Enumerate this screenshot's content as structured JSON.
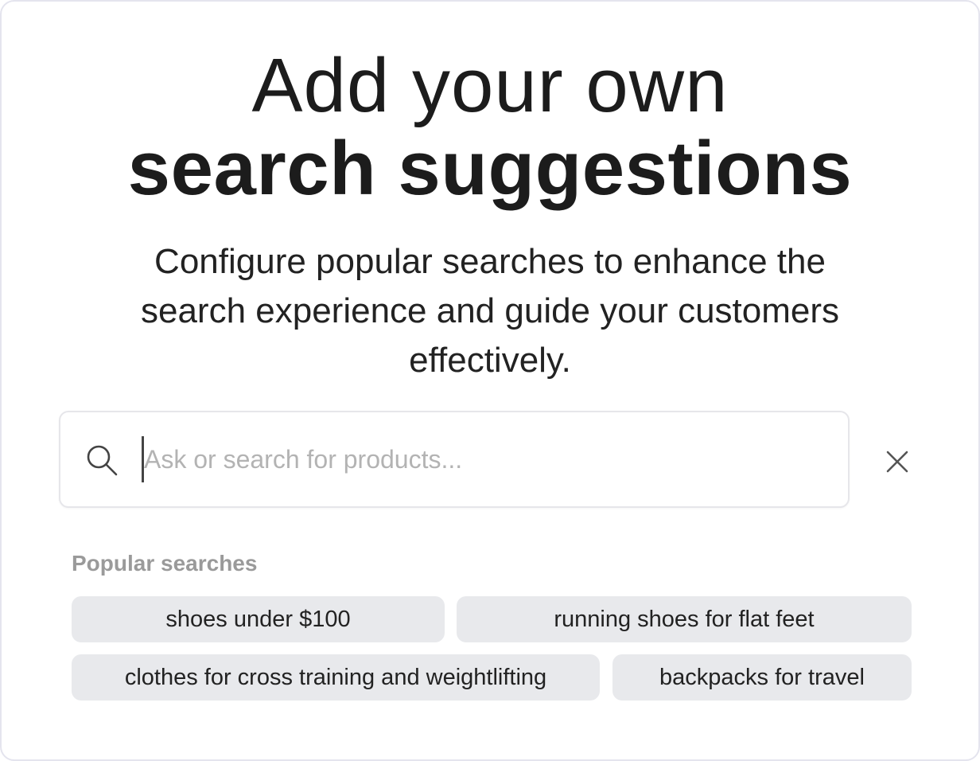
{
  "heading": {
    "line1": "Add your own",
    "line2": "search suggestions"
  },
  "description": "Configure popular searches to enhance the search experience and guide your customers effectively.",
  "search": {
    "placeholder": "Ask or search for products...",
    "value": ""
  },
  "icons": {
    "search": "search-icon",
    "close": "close-icon"
  },
  "popular": {
    "label": "Popular searches",
    "items": [
      "shoes under $100",
      "running shoes for flat feet",
      "clothes for cross training and weightlifting",
      "backpacks for travel"
    ]
  },
  "colors": {
    "chip_background": "#e8e9ec",
    "placeholder_text": "#b3b3b3",
    "label_text": "#9a9a9a",
    "border": "#e6e6ea"
  }
}
